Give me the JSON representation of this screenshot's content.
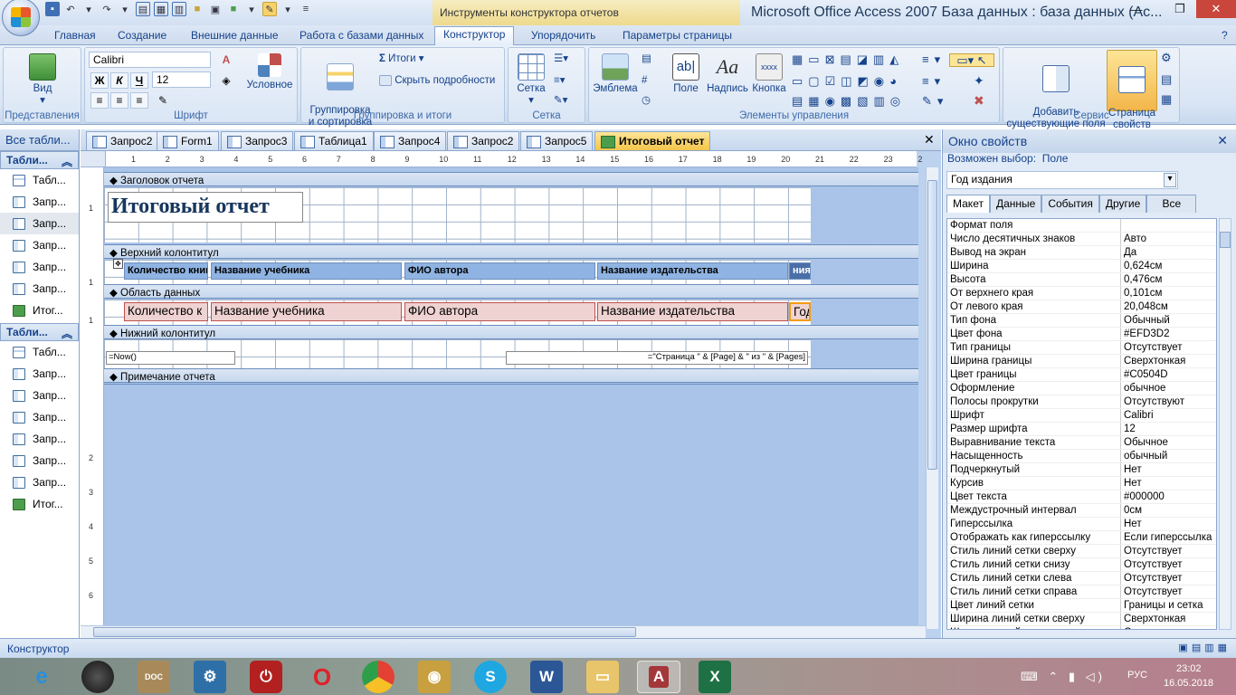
{
  "window": {
    "context_tools": "Инструменты конструктора отчетов",
    "title": "Microsoft Office Access 2007 База данных : база данных (Ac..."
  },
  "ribbon_tabs": [
    "Главная",
    "Создание",
    "Внешние данные",
    "Работа с базами данных",
    "Конструктор",
    "Упорядочить",
    "Параметры страницы"
  ],
  "ribbon": {
    "views": {
      "view_label": "Вид",
      "group": "Представления"
    },
    "font": {
      "font_name": "Calibri",
      "font_size": "12",
      "bold": "Ж",
      "italic": "К",
      "underline": "Ч",
      "conditional": "Условное",
      "group": "Шрифт"
    },
    "grouping": {
      "group_sort": "Группировка\nи сортировка",
      "totals": "Итоги",
      "hide_details": "Скрыть подробности",
      "group": "Группировка и итоги"
    },
    "grid": {
      "grid_label": "Сетка",
      "group": "Сетка"
    },
    "controls": {
      "logo": "Эмблема",
      "field": "Поле",
      "label": "Надпись",
      "button": "Кнопка",
      "group": "Элементы управления"
    },
    "tools": {
      "add_fields": "Добавить\nсуществующие поля",
      "property_sheet": "Страница\nсвойств",
      "group": "Сервис"
    }
  },
  "nav": {
    "header": "Все табли...",
    "groups": [
      {
        "title": "Табли...",
        "items": [
          "Табл...",
          "Запр...",
          "Запр...",
          "Запр...",
          "Запр...",
          "Запр...",
          "Итог..."
        ]
      },
      {
        "title": "Табли...",
        "items": [
          "Табл...",
          "Запр...",
          "Запр...",
          "Запр...",
          "Запр...",
          "Запр...",
          "Запр...",
          "Итог..."
        ]
      }
    ]
  },
  "doc_tabs": [
    "Запрос2",
    "Form1",
    "Запрос3",
    "Таблица1",
    "Запрос4",
    "Запрос2",
    "Запрос5",
    "Итоговый отчет"
  ],
  "report": {
    "sections": [
      "Заголовок отчета",
      "Верхний колонтитул",
      "Область данных",
      "Нижний колонтитул",
      "Примечание отчета"
    ],
    "title": "Итоговый отчет",
    "header_labels": [
      "Количество книг",
      "Название учебника",
      "ФИО автора",
      "Название издательства",
      "ния"
    ],
    "detail_fields": [
      "Количество к",
      "Название учебника",
      "ФИО автора",
      "Название издательства",
      "Год"
    ],
    "footer_now": "=Now()",
    "footer_pages": "=\"Страница \" & [Page] & \" из \" & [Pages]",
    "ruler_top": [
      "1",
      "2",
      "3",
      "4",
      "5",
      "6",
      "7",
      "8",
      "9",
      "10",
      "11",
      "12",
      "13",
      "14",
      "15",
      "16",
      "17",
      "18",
      "19",
      "20",
      "21",
      "22",
      "23",
      "2"
    ],
    "ruler_left": [
      "1",
      "1",
      "1",
      "2",
      "3",
      "4",
      "5",
      "6"
    ]
  },
  "props": {
    "title": "Окно свойств",
    "selection_type_label": "Возможен выбор:",
    "selection_type": "Поле",
    "selected": "Год издания",
    "tabs": [
      "Макет",
      "Данные",
      "События",
      "Другие",
      "Все"
    ],
    "rows": [
      [
        "Формат поля",
        ""
      ],
      [
        "Число десятичных знаков",
        "Авто"
      ],
      [
        "Вывод на экран",
        "Да"
      ],
      [
        "Ширина",
        "0,624см"
      ],
      [
        "Высота",
        "0,476см"
      ],
      [
        "От верхнего края",
        "0,101см"
      ],
      [
        "От левого края",
        "20,048см"
      ],
      [
        "Тип фона",
        "Обычный"
      ],
      [
        "Цвет фона",
        "#EFD3D2"
      ],
      [
        "Тип границы",
        "Отсутствует"
      ],
      [
        "Ширина границы",
        "Сверхтонкая"
      ],
      [
        "Цвет границы",
        "#C0504D"
      ],
      [
        "Оформление",
        "обычное"
      ],
      [
        "Полосы прокрутки",
        "Отсутствуют"
      ],
      [
        "Шрифт",
        "Calibri"
      ],
      [
        "Размер шрифта",
        "12"
      ],
      [
        "Выравнивание текста",
        "Обычное"
      ],
      [
        "Насыщенность",
        "обычный"
      ],
      [
        "Подчеркнутый",
        "Нет"
      ],
      [
        "Курсив",
        "Нет"
      ],
      [
        "Цвет текста",
        "#000000"
      ],
      [
        "Междустрочный интервал",
        "0см"
      ],
      [
        "Гиперссылка",
        "Нет"
      ],
      [
        "Отображать как гиперссылку",
        "Если гиперссылка"
      ],
      [
        "Стиль линий сетки сверху",
        "Отсутствует"
      ],
      [
        "Стиль линий сетки снизу",
        "Отсутствует"
      ],
      [
        "Стиль линий сетки слева",
        "Отсутствует"
      ],
      [
        "Стиль линий сетки справа",
        "Отсутствует"
      ],
      [
        "Цвет линий сетки",
        "Границы и сетка"
      ],
      [
        "Ширина линий сетки сверху",
        "Сверхтонкая"
      ],
      [
        "Ширина линий сетки снизу",
        "Сверхтонкая"
      ]
    ]
  },
  "status": "Конструктор",
  "taskbar": {
    "lang": "РУС",
    "time": "23:02",
    "date": "16.05.2018"
  }
}
